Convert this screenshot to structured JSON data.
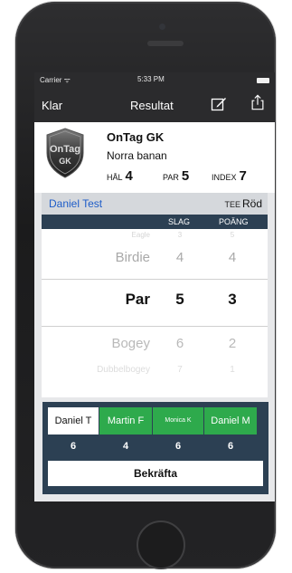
{
  "status_bar": {
    "carrier": "Carrier ᯤ",
    "time": "5:33 PM"
  },
  "navbar": {
    "left": "Klar",
    "title": "Resultat"
  },
  "course": {
    "name": "OnTag GK",
    "subtitle": "Norra banan",
    "logo_line1": "OnTag",
    "logo_line2": "GK",
    "hal_label": "HÅL",
    "hal_value": "4",
    "par_label": "PAR",
    "par_value": "5",
    "index_label": "INDEX",
    "index_value": "7"
  },
  "player": {
    "name": "Daniel Test",
    "tee_label": "TEE",
    "tee_value": "Röd"
  },
  "columns": {
    "slag": "SLAG",
    "poang": "POÄNG"
  },
  "picker": {
    "rows": [
      {
        "label": "Eagle",
        "slag": "3",
        "poang": "5"
      },
      {
        "label": "Birdie",
        "slag": "4",
        "poang": "4"
      },
      {
        "label": "Par",
        "slag": "5",
        "poang": "3"
      },
      {
        "label": "Bogey",
        "slag": "6",
        "poang": "2"
      },
      {
        "label": "Dubbelbogey",
        "slag": "7",
        "poang": "1"
      }
    ]
  },
  "players_panel": {
    "players": [
      {
        "name": "Daniel T",
        "score": "6",
        "state": "active"
      },
      {
        "name": "Martin F",
        "score": "4",
        "state": "done"
      },
      {
        "name": "Monica K",
        "score": "6",
        "state": "done"
      },
      {
        "name": "Daniel M",
        "score": "6",
        "state": "done"
      }
    ],
    "confirm_label": "Bekräfta"
  },
  "colors": {
    "navbar": "#2b2b2d",
    "header_blue": "#2c4053",
    "player_name": "#1d5cc8",
    "done_green": "#2eaa4c"
  },
  "icons": [
    "compose-icon",
    "share-icon",
    "wifi-icon",
    "battery-icon"
  ]
}
